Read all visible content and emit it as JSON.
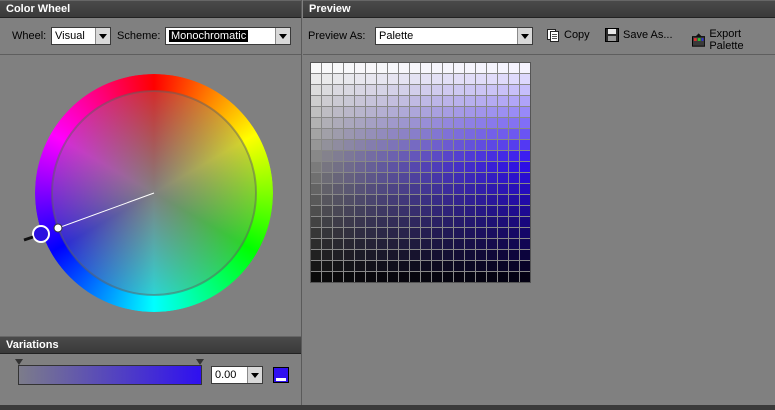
{
  "left_panel": {
    "title": "Color Wheel",
    "wheel_label": "Wheel:",
    "wheel_value": "Visual",
    "scheme_label": "Scheme:",
    "scheme_value": "Monochromatic"
  },
  "variations": {
    "title": "Variations",
    "value": "0.00",
    "gradient_start": "#7c7c8a",
    "gradient_end": "#2f10f0",
    "swatch_color": "#3010f0"
  },
  "right_panel": {
    "title": "Preview",
    "preview_label": "Preview As:",
    "preview_value": "Palette",
    "copy_label": "Copy",
    "copy_icon": "copy-icon",
    "save_label": "Save As...",
    "save_icon": "floppy-disk-icon",
    "export_label": "Export Palette",
    "export_icon": "export-icon"
  },
  "palette": {
    "base_color": "#2f10f0",
    "rows": 20,
    "cols": 20
  }
}
